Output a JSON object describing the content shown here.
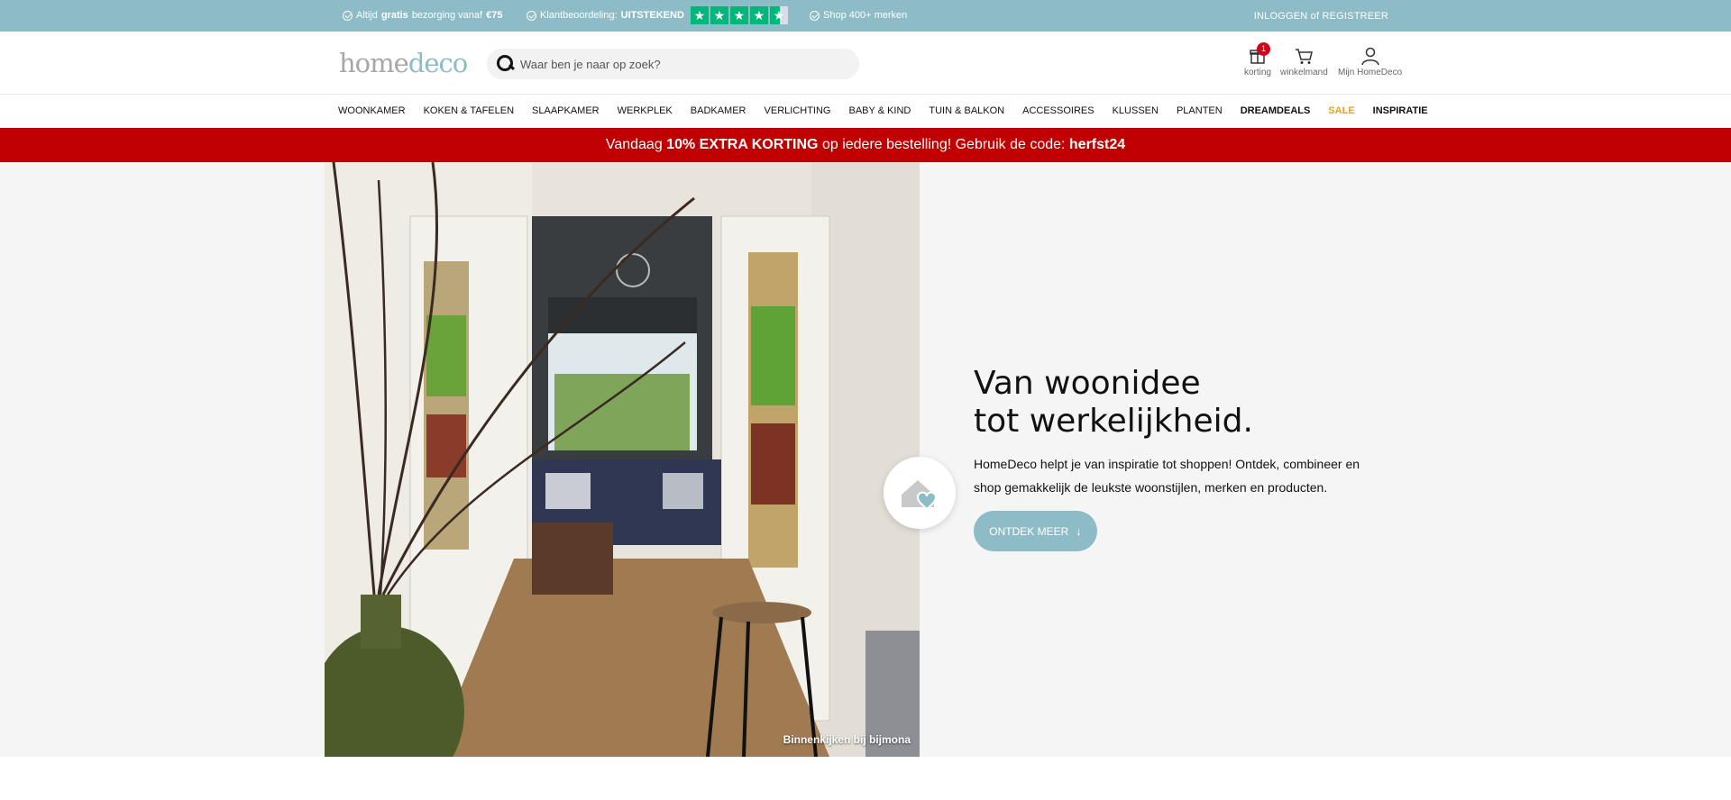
{
  "topbar": {
    "usp1_a": "Altijd",
    "usp1_b": "gratis",
    "usp1_c": "bezorging vanaf",
    "usp1_d": "€75",
    "usp2_a": "Klantbeoordeling:",
    "usp2_b": "UITSTEKEND",
    "usp3": "Shop 400+ merken",
    "login": "INLOGGEN of REGISTREER"
  },
  "header": {
    "logo_home": "home",
    "logo_deco": "deco",
    "search_placeholder": "Waar ben je naar op zoek?",
    "korting_label": "korting",
    "korting_badge": "1",
    "cart_label": "winkelmand",
    "account_label": "Mijn HomeDeco"
  },
  "nav": {
    "items": [
      "WOONKAMER",
      "KOKEN & TAFELEN",
      "SLAAPKAMER",
      "WERKPLEK",
      "BADKAMER",
      "VERLICHTING",
      "BABY & KIND",
      "TUIN & BALKON",
      "ACCESSOIRES",
      "KLUSSEN",
      "PLANTEN",
      "DREAMDEALS",
      "SALE",
      "INSPIRATIE"
    ]
  },
  "promo": {
    "a": "Vandaag ",
    "b": "10% EXTRA KORTING",
    "c": " op iedere bestelling! Gebruik de code: ",
    "d": "herfst24"
  },
  "hero": {
    "title_line1": "Van woonidee",
    "title_line2": "tot werkelijkheid.",
    "text": "HomeDeco helpt je van inspiratie tot shoppen! Ontdek, combineer en shop gemakkelijk de leukste woonstijlen, merken en producten.",
    "cta": "ONTDEK MEER",
    "caption": "Binnenkijken bij bijmona"
  },
  "colors": {
    "accent": "#8dbcc7",
    "promo": "#c00000",
    "sale": "#e8a21a",
    "trustpilot": "#00b67a"
  }
}
